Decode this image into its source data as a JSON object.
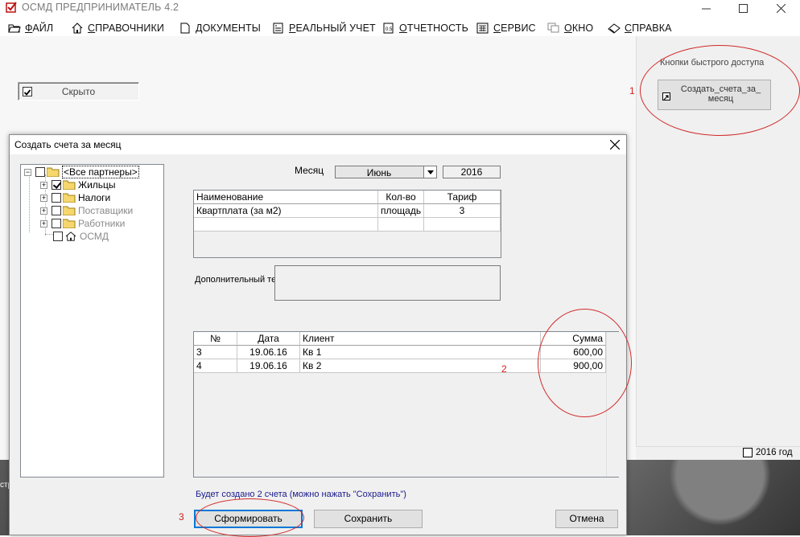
{
  "app": {
    "title": "ОСМД ПРЕДПРИНИМАТЕЛЬ 4.2",
    "logo_icon": "checkbox-logo-icon"
  },
  "window_controls": {
    "minimize": "—",
    "maximize": "☐",
    "close": "✕"
  },
  "menu": [
    {
      "label": "ФАЙЛ",
      "icon": "folder-open-icon"
    },
    {
      "label": "СПРАВОЧНИКИ",
      "icon": "home-icon"
    },
    {
      "label": "ДОКУМЕНТЫ",
      "icon": "document-icon"
    },
    {
      "label": "РЕАЛЬНЫЙ УЧЕТ",
      "icon": "ledger-icon"
    },
    {
      "label": "ОТЧЕТНОСТЬ",
      "icon": "report-icon"
    },
    {
      "label": "СЕРВИС",
      "icon": "calculator-icon"
    },
    {
      "label": "ОКНО",
      "icon": "window-icon"
    },
    {
      "label": "СПРАВКА",
      "icon": "help-book-icon"
    }
  ],
  "workspace": {
    "hidden_toggle_label": "Скрыто"
  },
  "quick_access": {
    "title": "Кнопки быстрого доступа",
    "button_label": "Создать_счета_за_ месяц"
  },
  "status": {
    "year": "2016 год"
  },
  "desktop": {
    "partial_label": "стр"
  },
  "dialog": {
    "title": "Создать счета за месяц",
    "close_label": "✕",
    "tree": [
      {
        "label": "<Все партнеры>",
        "checked": false,
        "expander": "⊟"
      },
      {
        "label": "Жильцы",
        "checked": true,
        "expander": "+"
      },
      {
        "label": "Налоги",
        "checked": false,
        "expander": "+"
      },
      {
        "label": "Поставщики",
        "checked": false,
        "expander": "+"
      },
      {
        "label": "Работники",
        "checked": false,
        "expander": "+"
      },
      {
        "label": "ОСМД",
        "checked": false,
        "expander": ""
      }
    ],
    "month_label": "Месяц",
    "month_value": "Июнь",
    "year_value": "2016",
    "tariff_grid": {
      "headers": [
        "Наименование",
        "Кол-во",
        "Тариф"
      ],
      "rows": [
        [
          "Квартплата (за м2)",
          "площадь",
          "3"
        ]
      ]
    },
    "extra_text_label": "Дополнительный текст",
    "extra_text_value": "",
    "invoice_grid": {
      "headers": [
        "№",
        "Дата",
        "Клиент",
        "Сумма"
      ],
      "rows": [
        [
          "3",
          "19.06.16",
          "Кв 1",
          "600,00"
        ],
        [
          "4",
          "19.06.16",
          "Кв 2",
          "900,00"
        ]
      ]
    },
    "info_text": "Будет создано 2 счета   (можно нажать \"Сохранить\")",
    "buttons": {
      "generate": "Сформировать",
      "save": "Сохранить",
      "cancel": "Отмена"
    }
  },
  "annotations": {
    "marker_1": "1",
    "marker_2": "2",
    "marker_3": "3",
    "color": "#d41c1c"
  }
}
